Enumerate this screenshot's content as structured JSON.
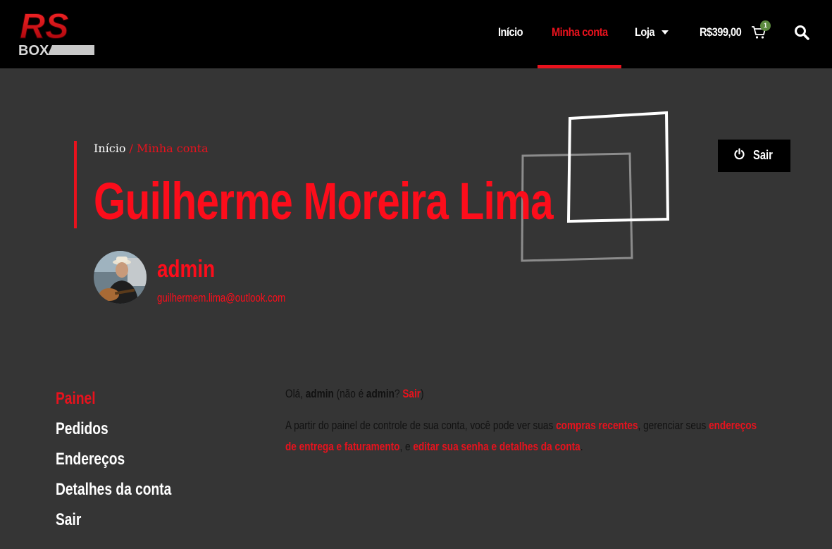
{
  "header": {
    "logo": {
      "text_top": "RS",
      "text_bottom": "BOX"
    },
    "nav": [
      {
        "label": "Início"
      },
      {
        "label": "Minha conta",
        "active": true
      },
      {
        "label": "Loja"
      }
    ],
    "cart_total": "R$399,00",
    "cart_count": "1"
  },
  "hero": {
    "breadcrumb": {
      "home": "Início",
      "separator": "/",
      "current": "Minha conta"
    },
    "title": "Guilherme Moreira Lima",
    "logout_label": "Sair",
    "username": "admin",
    "email": "guilhermem.lima@outlook.com"
  },
  "account_nav": [
    {
      "label": "Painel",
      "active": true
    },
    {
      "label": "Pedidos"
    },
    {
      "label": "Endereços"
    },
    {
      "label": "Detalhes da conta"
    },
    {
      "label": "Sair"
    }
  ],
  "content": {
    "greeting": {
      "hello": "Olá,",
      "user": "admin",
      "not_is": "(não é",
      "user2": "admin",
      "question": "?",
      "logout_link": "Sair",
      "close": ")"
    },
    "intro": {
      "part1": "A partir do painel de controle de sua conta, você pode ver suas",
      "link1": "compras recentes",
      "part2": ", gerenciar seus",
      "link2a": "endereços",
      "link2b": "de entrega e faturamento",
      "part3": ", e",
      "link3": "editar sua senha e detalhes da conta",
      "part4": "."
    }
  },
  "colors": {
    "accent": "#e8121d",
    "background": "#353535",
    "header": "#000000"
  },
  "icons": [
    "caret-down-icon",
    "cart-icon",
    "search-icon",
    "power-icon"
  ]
}
